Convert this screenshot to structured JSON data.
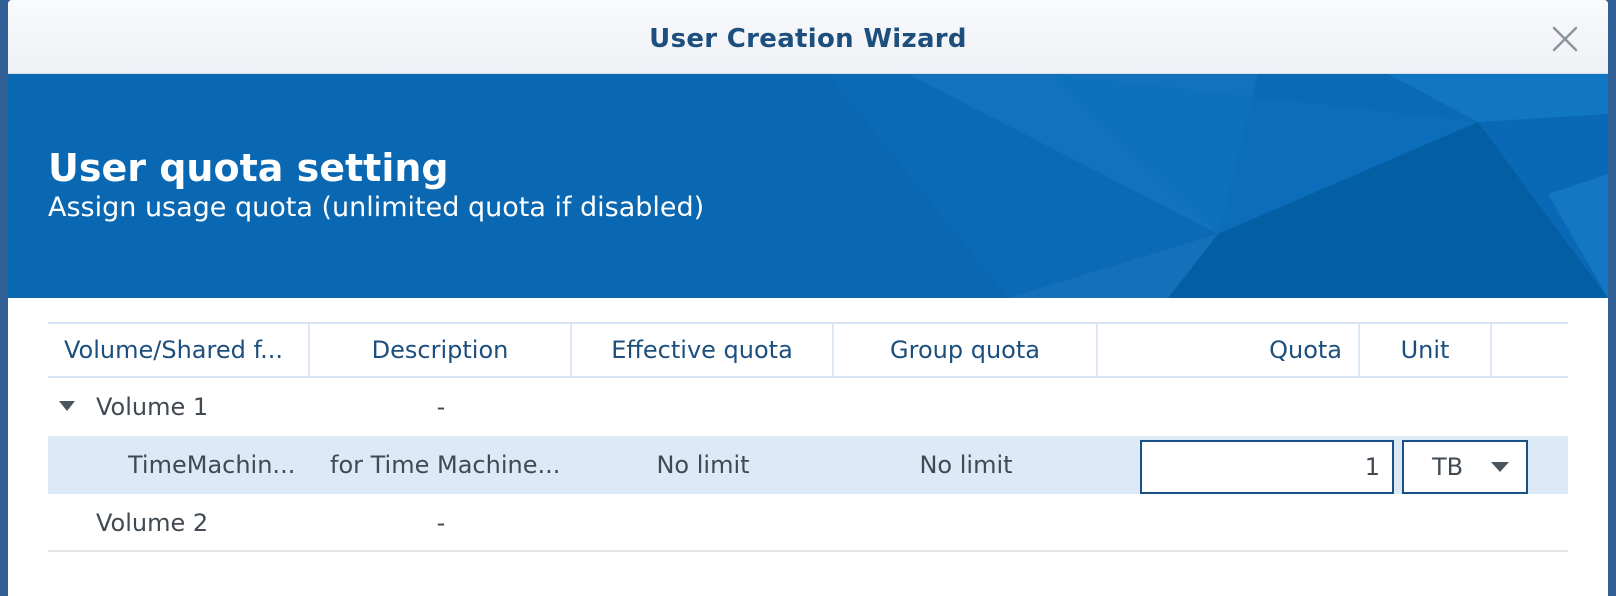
{
  "window": {
    "title": "User Creation Wizard"
  },
  "banner": {
    "title": "User quota setting",
    "subtitle": "Assign usage quota (unlimited quota if disabled)"
  },
  "table": {
    "columns": [
      "Volume/Shared f...",
      "Description",
      "Effective quota",
      "Group quota",
      "Quota",
      "Unit"
    ],
    "rows": [
      {
        "name": "Volume 1",
        "description": "-",
        "expanded": true
      },
      {
        "name": "TimeMachin...",
        "description": "for Time Machine...",
        "effective_quota": "No limit",
        "group_quota": "No limit",
        "quota": "1",
        "unit": "TB",
        "selected": true
      },
      {
        "name": "Volume 2",
        "description": "-"
      }
    ]
  },
  "colors": {
    "banner": "#0a67b1",
    "title_text": "#1d4f7e",
    "selected_row": "#dceaf8"
  },
  "icons": [
    "close-icon",
    "expand-triangle-icon",
    "dropdown-caret-icon"
  ]
}
